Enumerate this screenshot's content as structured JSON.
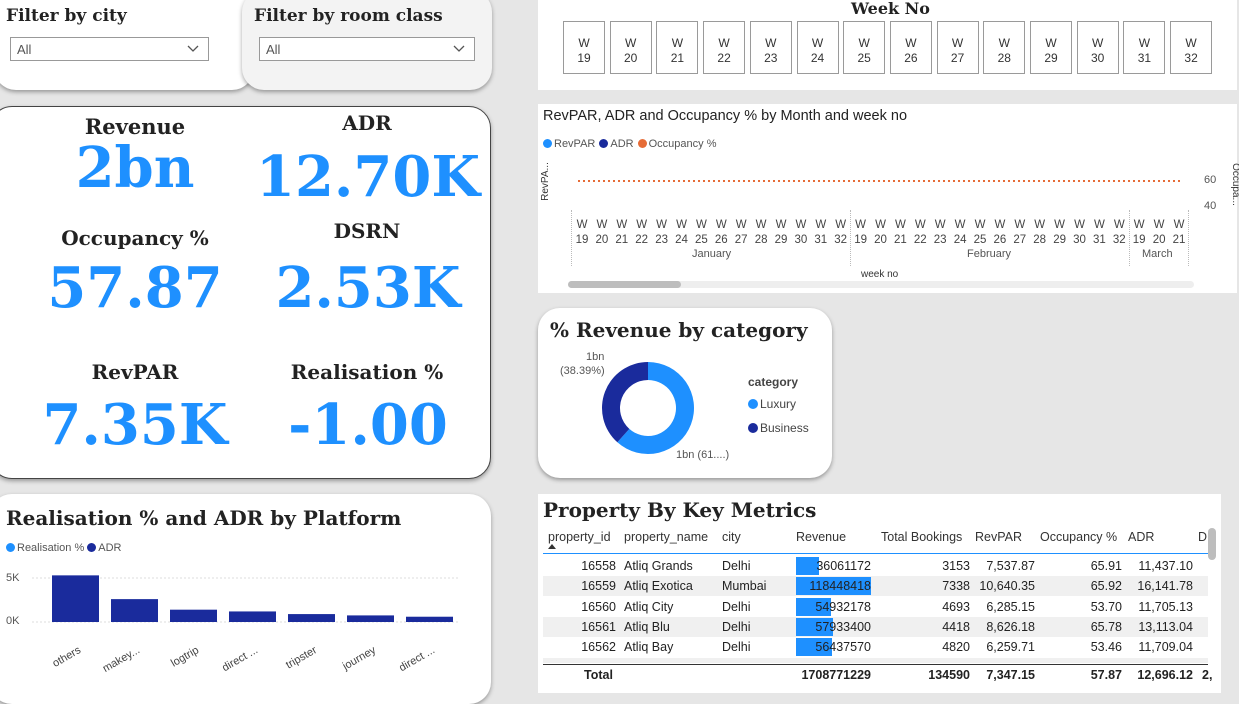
{
  "filters": {
    "city": {
      "title": "Filter by city",
      "value": "All"
    },
    "room_class": {
      "title": "Filter by room class",
      "value": "All"
    }
  },
  "kpis": {
    "revenue": {
      "label": "Revenue",
      "value": "2bn"
    },
    "adr": {
      "label": "ADR",
      "value": "12.70K"
    },
    "occupancy": {
      "label": "Occupancy %",
      "value": "57.87"
    },
    "dsrn": {
      "label": "DSRN",
      "value": "2.53K"
    },
    "revpar": {
      "label": "RevPAR",
      "value": "7.35K"
    },
    "realisation": {
      "label": "Realisation %",
      "value": "-1.00"
    }
  },
  "week_slicer": {
    "title": "Week No",
    "weeks": [
      [
        "W",
        "19"
      ],
      [
        "W",
        "20"
      ],
      [
        "W",
        "21"
      ],
      [
        "W",
        "22"
      ],
      [
        "W",
        "23"
      ],
      [
        "W",
        "24"
      ],
      [
        "W",
        "25"
      ],
      [
        "W",
        "26"
      ],
      [
        "W",
        "27"
      ],
      [
        "W",
        "28"
      ],
      [
        "W",
        "29"
      ],
      [
        "W",
        "30"
      ],
      [
        "W",
        "31"
      ],
      [
        "W",
        "32"
      ]
    ]
  },
  "trend_chart": {
    "title": "RevPAR, ADR and Occupancy % by Month and week no",
    "legend": [
      {
        "name": "RevPAR",
        "color": "#1e90ff"
      },
      {
        "name": "ADR",
        "color": "#1a2b9c"
      },
      {
        "name": "Occupancy %",
        "color": "#e66c37"
      }
    ],
    "y_left_label": "RevPA...",
    "y_right_label": "Occupa...",
    "y_right_ticks": [
      "60",
      "40"
    ],
    "x_label": "week no",
    "months": [
      "January",
      "February",
      "March"
    ],
    "week_numbers": [
      "19",
      "20",
      "21",
      "22",
      "23",
      "24",
      "25",
      "26",
      "27",
      "28",
      "29",
      "30",
      "31",
      "32",
      "19",
      "20",
      "21",
      "22",
      "23",
      "24",
      "25",
      "26",
      "27",
      "28",
      "29",
      "30",
      "31",
      "32",
      "19",
      "20",
      "21"
    ],
    "week_prefix": "W"
  },
  "revenue_category": {
    "title": "% Revenue by category",
    "legend_title": "category",
    "categories": [
      {
        "name": "Luxury",
        "color": "#1e90ff"
      },
      {
        "name": "Business",
        "color": "#1a2b9c"
      }
    ],
    "label_business_value": "1bn",
    "label_business_pct": "(38.39%)",
    "label_luxury": "1bn (61....)"
  },
  "platform_chart": {
    "title": "Realisation % and ADR by Platform",
    "legend": [
      {
        "name": "Realisation %",
        "color": "#1e90ff"
      },
      {
        "name": "ADR",
        "color": "#1a2b9c"
      }
    ],
    "y_ticks": [
      "5K",
      "0K"
    ],
    "color": "#1a2b9c"
  },
  "chart_data": [
    {
      "type": "line",
      "title": "RevPAR, ADR and Occupancy % by Month and week no",
      "xlabel": "week no",
      "series": [
        {
          "name": "Occupancy %",
          "values": [
            58
          ]
        }
      ],
      "y_right_ticks": [
        60,
        40
      ]
    },
    {
      "type": "pie",
      "title": "% Revenue by category",
      "categories": [
        "Luxury",
        "Business"
      ],
      "values": [
        61.61,
        38.39
      ]
    },
    {
      "type": "bar",
      "title": "Realisation % and ADR by Platform",
      "categories": [
        "others",
        "makey...",
        "logtrip",
        "direct ...",
        "tripster",
        "journey",
        "direct ..."
      ],
      "series": [
        {
          "name": "ADR",
          "values": [
            5300,
            2600,
            1400,
            1200,
            900,
            750,
            600
          ]
        }
      ],
      "ylim": [
        0,
        6000
      ]
    }
  ],
  "property_table": {
    "title": "Property By Key Metrics",
    "columns": [
      "property_id",
      "property_name",
      "city",
      "Revenue",
      "Total Bookings",
      "RevPAR",
      "Occupancy %",
      "ADR",
      "D"
    ],
    "rows": [
      [
        "16558",
        "Atliq Grands",
        "Delhi",
        "36061172",
        "3153",
        "7,537.87",
        "65.91",
        "11,437.10"
      ],
      [
        "16559",
        "Atliq Exotica",
        "Mumbai",
        "118448418",
        "7338",
        "10,640.35",
        "65.92",
        "16,141.78"
      ],
      [
        "16560",
        "Atliq City",
        "Delhi",
        "54932178",
        "4693",
        "6,285.15",
        "53.70",
        "11,705.13"
      ],
      [
        "16561",
        "Atliq Blu",
        "Delhi",
        "57933400",
        "4418",
        "8,626.18",
        "65.78",
        "13,113.04"
      ],
      [
        "16562",
        "Atliq Bay",
        "Delhi",
        "56437570",
        "4820",
        "6,259.71",
        "53.46",
        "11,709.04"
      ]
    ],
    "revenue_fraction": [
      0.3,
      1.0,
      0.46,
      0.49,
      0.48
    ],
    "total": [
      "Total",
      "1708771229",
      "134590",
      "7,347.15",
      "57.87",
      "12,696.12",
      "2,"
    ]
  }
}
